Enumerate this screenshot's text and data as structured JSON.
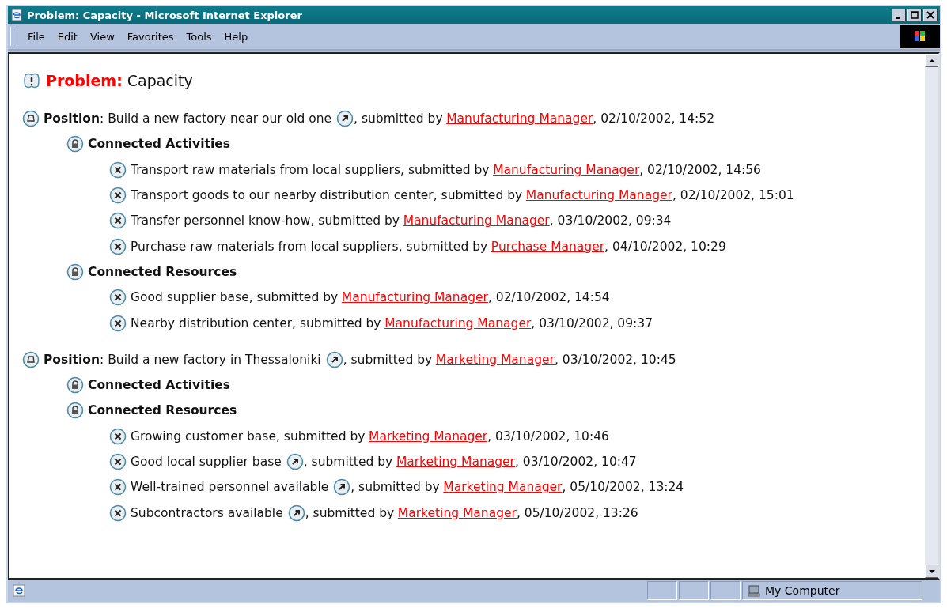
{
  "window": {
    "title": "Problem: Capacity - Microsoft Internet Explorer"
  },
  "menu": [
    {
      "label": "File"
    },
    {
      "label": "Edit"
    },
    {
      "label": "View"
    },
    {
      "label": "Favorites"
    },
    {
      "label": "Tools"
    },
    {
      "label": "Help"
    }
  ],
  "problem": {
    "label": "Problem:",
    "title": "Capacity"
  },
  "positions": [
    {
      "label": "**Position**:",
      "text": "Build a new factory near our old one",
      "linked": true,
      "by": ", submitted by",
      "author": "Manufacturing Manager",
      "date": ", 02/10/2002, 14:52",
      "groups": [
        {
          "title": "Connected Activities",
          "items": [
            {
              "text": "Transport raw materials from local suppliers",
              "linked": false,
              "by": ", submitted by",
              "author": "Manufacturing Manager",
              "date": ", 02/10/2002, 14:56"
            },
            {
              "text": "Transport goods to our nearby distribution center",
              "linked": false,
              "by": ", submitted by",
              "author": "Manufacturing Manager",
              "date": ", 02/10/2002, 15:01"
            },
            {
              "text": "Transfer personnel know-how",
              "linked": false,
              "by": ", submitted by",
              "author": "Manufacturing Manager",
              "date": ", 03/10/2002, 09:34"
            },
            {
              "text": "Purchase raw materials from local suppliers",
              "linked": false,
              "by": ", submitted by",
              "author": "Purchase Manager",
              "date": ", 04/10/2002, 10:29"
            }
          ]
        },
        {
          "title": "Connected Resources",
          "items": [
            {
              "text": "Good supplier base",
              "linked": false,
              "by": ", submitted by",
              "author": "Manufacturing Manager",
              "date": ", 02/10/2002, 14:54"
            },
            {
              "text": "Nearby distribution center",
              "linked": false,
              "by": ", submitted by",
              "author": "Manufacturing Manager",
              "date": ", 03/10/2002, 09:37"
            }
          ]
        }
      ]
    },
    {
      "label": "**Position**:",
      "text": "Build a new factory in Thessaloniki",
      "linked": true,
      "by": ", submitted by",
      "author": "Marketing Manager",
      "date": ", 03/10/2002, 10:45",
      "groups": [
        {
          "title": "Connected Activities"
        },
        {
          "title": "Connected Resources",
          "items": [
            {
              "text": "Growing customer base",
              "linked": false,
              "by": ", submitted by",
              "author": "Marketing Manager",
              "date": ", 03/10/2002, 10:46"
            },
            {
              "text": "Good local supplier base",
              "linked": true,
              "by": ", submitted by",
              "author": "Marketing Manager",
              "date": ", 03/10/2002, 10:47"
            },
            {
              "text": "Well-trained personnel available",
              "linked": true,
              "by": ", submitted by",
              "author": "Marketing Manager",
              "date": ", 05/10/2002, 13:24"
            },
            {
              "text": "Subcontractors available",
              "linked": true,
              "by": ", submitted by",
              "author": "Marketing Manager",
              "date": ", 05/10/2002, 13:26"
            }
          ]
        }
      ]
    }
  ],
  "status_bar": {
    "zone": "My Computer"
  }
}
